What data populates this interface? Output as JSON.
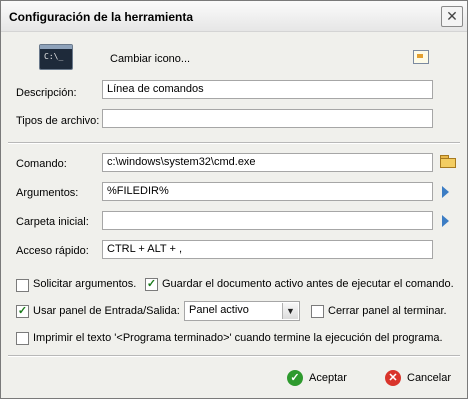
{
  "window": {
    "title": "Configuración de la herramienta"
  },
  "icon_row": {
    "change_icon_label": "Cambiar icono..."
  },
  "fields": {
    "description": {
      "label": "Descripción:",
      "value": "Línea de comandos"
    },
    "file_types": {
      "label": "Tipos de archivo:",
      "value": ""
    },
    "command": {
      "label": "Comando:",
      "value": "c:\\windows\\system32\\cmd.exe"
    },
    "arguments": {
      "label": "Argumentos:",
      "value": "%FILEDIR%"
    },
    "initial_folder": {
      "label": "Carpeta inicial:",
      "value": ""
    },
    "shortcut": {
      "label": "Acceso rápido:",
      "value": "CTRL + ALT + ,"
    }
  },
  "options": {
    "ask_arguments": {
      "label": "Solicitar argumentos.",
      "checked": false
    },
    "save_active_doc": {
      "label": "Guardar el documento activo antes de ejecutar el comando.",
      "checked": true
    },
    "use_io_panel": {
      "label": "Usar panel de Entrada/Salida:",
      "checked": true
    },
    "io_panel_select": {
      "value": "Panel activo"
    },
    "close_panel": {
      "label": "Cerrar panel al terminar.",
      "checked": false
    },
    "print_finished": {
      "label": "Imprimir el texto '<Programa terminado>' cuando termine la ejecución del programa.",
      "checked": false
    }
  },
  "buttons": {
    "accept": "Aceptar",
    "cancel": "Cancelar"
  },
  "icons": {
    "title_close": "close-icon",
    "tool_icon": "terminal-icon",
    "browse_icon": "image-browse-icon",
    "folder_icon": "folder-open-icon",
    "arrow_icon": "triangle-right-icon"
  },
  "colors": {
    "accept_icon": "#2e9a2e",
    "cancel_icon": "#d9342b",
    "arrow": "#3c7dc4"
  }
}
